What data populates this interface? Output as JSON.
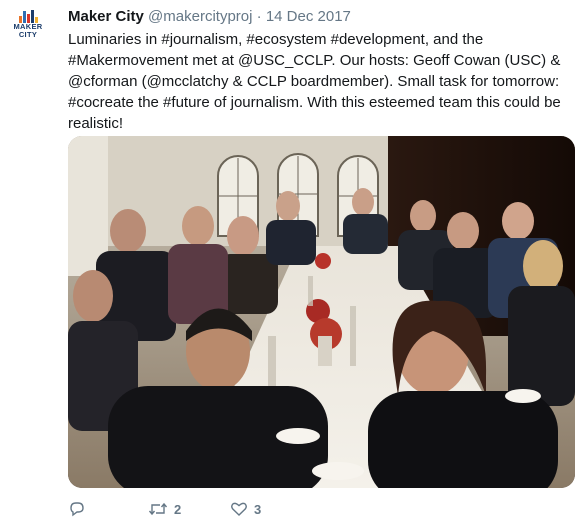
{
  "tweet": {
    "author_name": "Maker City",
    "handle": "@makercityproj",
    "separator": "·",
    "date": "14 Dec 2017",
    "text": "Luminaries in #journalism, #ecosystem #development, and the\n#Makermovement met at @USC_CCLP. Our hosts: Geoff Cowan (USC) &\n@cforman (@mcclatchy & CCLP boardmember). Small task for tomorrow:\n#cocreate the #future of journalism. With this esteemed team this could be\nrealistic!",
    "avatar": {
      "line1": "MAKER",
      "line2": "CITY"
    }
  },
  "actions": {
    "reply_icon": "reply-icon",
    "retweet_icon": "retweet-icon",
    "retweet_count": "2",
    "like_icon": "heart-icon",
    "like_count": "3"
  },
  "colors": {
    "name": "#14171a",
    "meta": "#657786",
    "logo": "#1c3d6b"
  }
}
